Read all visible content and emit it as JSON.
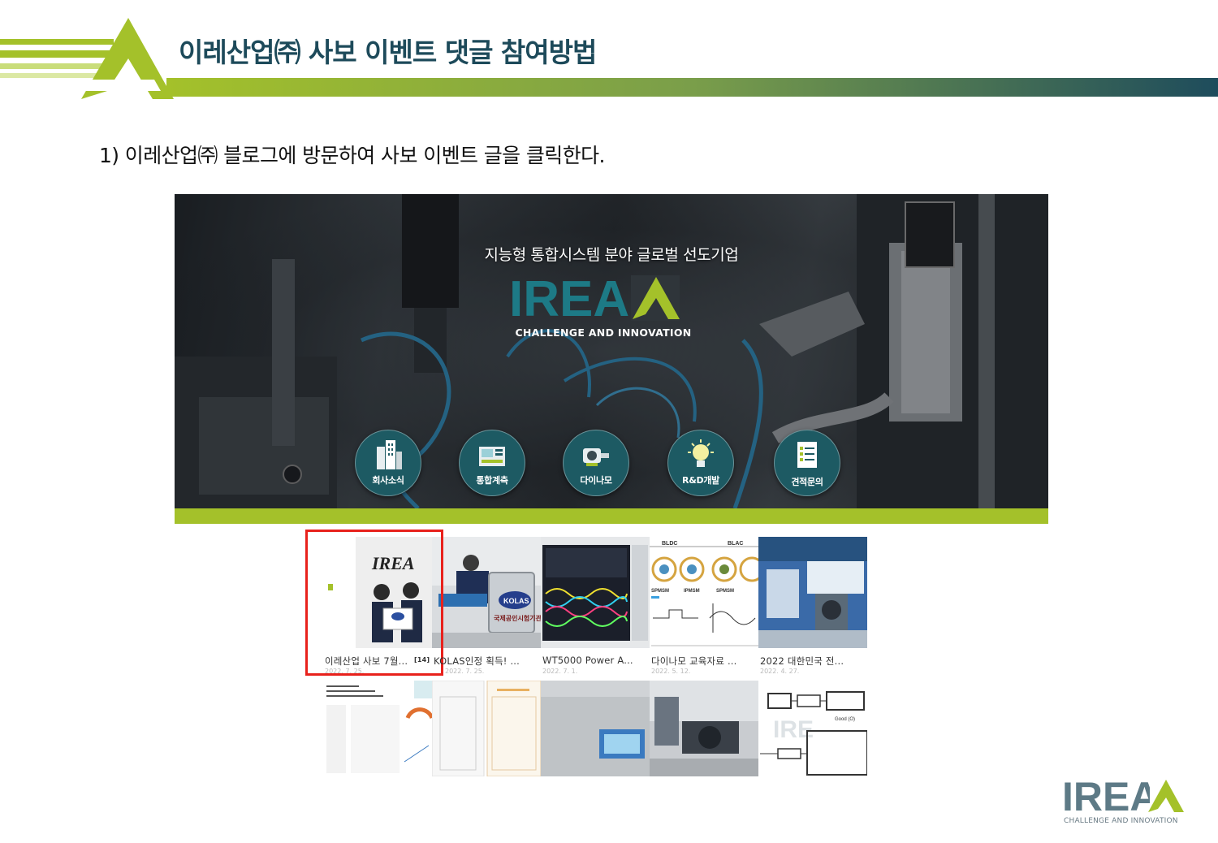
{
  "slide": {
    "title": "이레산업㈜ 사보 이벤트 댓글 참여방법",
    "instruction": "1) 이레산업㈜ 블로그에 방문하여 사보 이벤트 글을 클릭한다."
  },
  "banner": {
    "tagline": "지능형 통합시스템 분야 글로벌 선도기업",
    "logo_text": "IREA",
    "slogan": "CHALLENGE AND INNOVATION",
    "menu": [
      {
        "label": "회사소식",
        "icon": "building-icon"
      },
      {
        "label": "통합계측",
        "icon": "measurement-device-icon"
      },
      {
        "label": "다이나모",
        "icon": "motor-icon"
      },
      {
        "label": "R&D개발",
        "icon": "lightbulb-icon"
      },
      {
        "label": "견적문의",
        "icon": "document-icon"
      }
    ]
  },
  "posts": [
    {
      "title": "이레산업 사보 7월...",
      "comments": "[14]",
      "date": "2022. 7. 25.",
      "cover_text": "IREA",
      "highlighted": true
    },
    {
      "title": "KOLAS인정 획득! ...",
      "date": "2022. 7. 25.",
      "badge_text": "KOLAS",
      "sign_text": "국제공인시험기관"
    },
    {
      "title": "WT5000 Power A...",
      "date": "2022. 7. 1."
    },
    {
      "title": "다이나모 교육자료 ...",
      "date": "2022. 5. 12.",
      "labels": [
        "BLDC",
        "BLAC",
        "SPMSM",
        "IPMSM",
        "SPMSM"
      ]
    },
    {
      "title": "2022 대한민국 전...",
      "date": "2022. 4. 27."
    },
    {
      "title": "",
      "date": ""
    },
    {
      "title": "",
      "date": ""
    },
    {
      "title": "",
      "date": ""
    },
    {
      "title": "",
      "date": ""
    },
    {
      "title": "",
      "date": "",
      "diagram_labels": [
        "Good (O)"
      ]
    }
  ],
  "footer": {
    "logo_text": "IREA",
    "slogan": "CHALLENGE AND INNOVATION"
  },
  "colors": {
    "brand_green": "#a4c12a",
    "brand_teal": "#1d4a5a",
    "highlight_red": "#e8211c"
  }
}
